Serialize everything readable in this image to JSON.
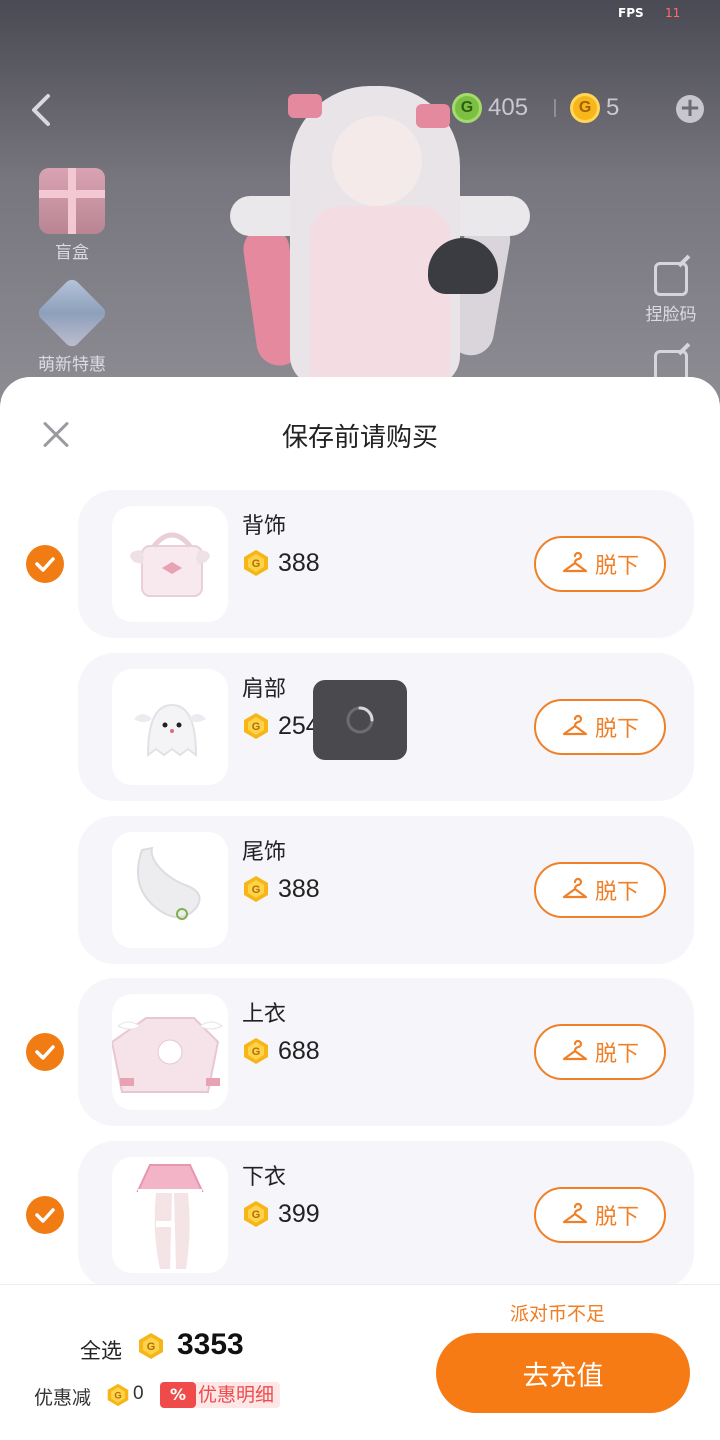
{
  "status": {
    "fps_label": "FPS",
    "fps_value": "11"
  },
  "header": {
    "green_currency": "405",
    "gold_currency": "5",
    "coin_glyph": "G"
  },
  "side_menu": {
    "left": [
      {
        "label": "盲盒",
        "icon": "blind-box-gift-icon"
      },
      {
        "label": "萌新特惠",
        "icon": "newbie-deal-icon"
      }
    ],
    "right": [
      {
        "label": "捏脸码",
        "icon": "face-code-edit-icon"
      },
      {
        "label": "",
        "icon": "share-icon"
      }
    ]
  },
  "sheet": {
    "title": "保存前请购买",
    "items": [
      {
        "name": "背饰",
        "price": "388",
        "checked": true,
        "button": "脱下",
        "thumb": "pink-bag"
      },
      {
        "name": "肩部",
        "price": "254",
        "checked": false,
        "button": "脱下",
        "thumb": "ghost-cat"
      },
      {
        "name": "尾饰",
        "price": "388",
        "checked": false,
        "button": "脱下",
        "thumb": "white-tail"
      },
      {
        "name": "上衣",
        "price": "688",
        "checked": true,
        "button": "脱下",
        "thumb": "pink-top"
      },
      {
        "name": "下衣",
        "price": "399",
        "checked": true,
        "button": "脱下",
        "thumb": "pink-skirt"
      }
    ]
  },
  "footer": {
    "select_all": "全选",
    "total": "3353",
    "discount_label": "优惠减",
    "discount_value": "0",
    "discount_badge": "%",
    "discount_detail": "优惠明细",
    "insufficient": "派对币不足",
    "recharge": "去充值"
  },
  "colors": {
    "accent": "#f77b14",
    "coin_gold": "#f7b71a",
    "coin_green": "#7bc043",
    "discount_red": "#ef4b4b"
  }
}
